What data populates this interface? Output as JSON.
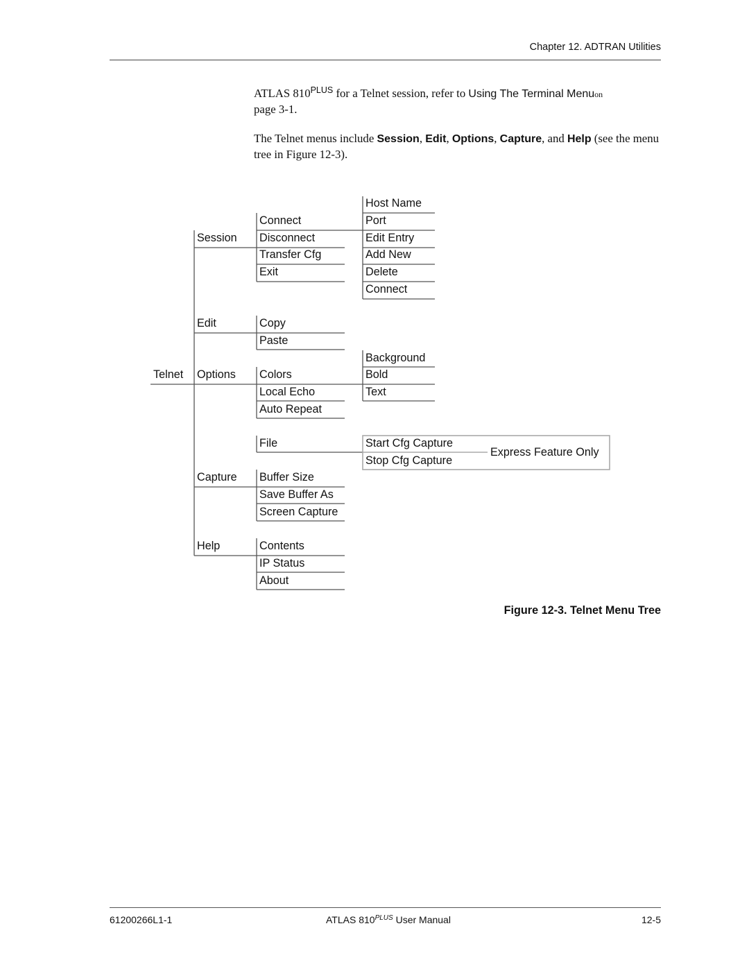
{
  "header": {
    "chapter": "Chapter 12.  ADTRAN Utilities"
  },
  "body": {
    "para1": {
      "product": "ATLAS 810",
      "product_sup": "PLUS",
      "text_a": " for a Telnet session, refer to ",
      "link": "Using The Terminal Menu",
      "text_b": "on",
      "text_c": "page 3-1."
    },
    "para2": {
      "text_a": "The Telnet menus include ",
      "m1": "Session",
      "sep1": ", ",
      "m2": "Edit",
      "sep2": ", ",
      "m3": "Options",
      "sep3": ", ",
      "m4": "Capture",
      "sep4": ", and ",
      "m5": "Help",
      "text_b": " (see the menu tree in Figure 12-3)."
    }
  },
  "tree": {
    "root": "Telnet",
    "menus": [
      {
        "label": "Session",
        "items": [
          "Connect",
          "Disconnect",
          "Transfer Cfg",
          "Exit"
        ],
        "submenu_of": "Connect",
        "subitems": [
          "Host Name",
          "Port",
          "Edit Entry",
          "Add New",
          "Delete",
          "Connect"
        ]
      },
      {
        "label": "Edit",
        "items": [
          "Copy",
          "Paste"
        ]
      },
      {
        "label": "Options",
        "items": [
          "Colors",
          "Local Echo",
          "Auto Repeat"
        ],
        "submenu_of": "Colors",
        "subitems": [
          "Background",
          "Bold",
          "Text"
        ]
      },
      {
        "label": "Capture",
        "items": [
          "File",
          "Buffer Size",
          "Save Buffer As",
          "Screen Capture"
        ],
        "submenu_of": "File",
        "subitems": [
          "Start Cfg Capture",
          "Stop Cfg Capture"
        ],
        "note": "Express Feature Only"
      },
      {
        "label": "Help",
        "items": [
          "Contents",
          "IP Status",
          "About"
        ]
      }
    ]
  },
  "figure": {
    "caption": "Figure 12-3.  Telnet Menu Tree"
  },
  "footer": {
    "doc_number": "61200266L1-1",
    "title_a": "ATLAS 810",
    "title_sup": "PLUS",
    "title_b": " User Manual",
    "page": "12-5"
  }
}
